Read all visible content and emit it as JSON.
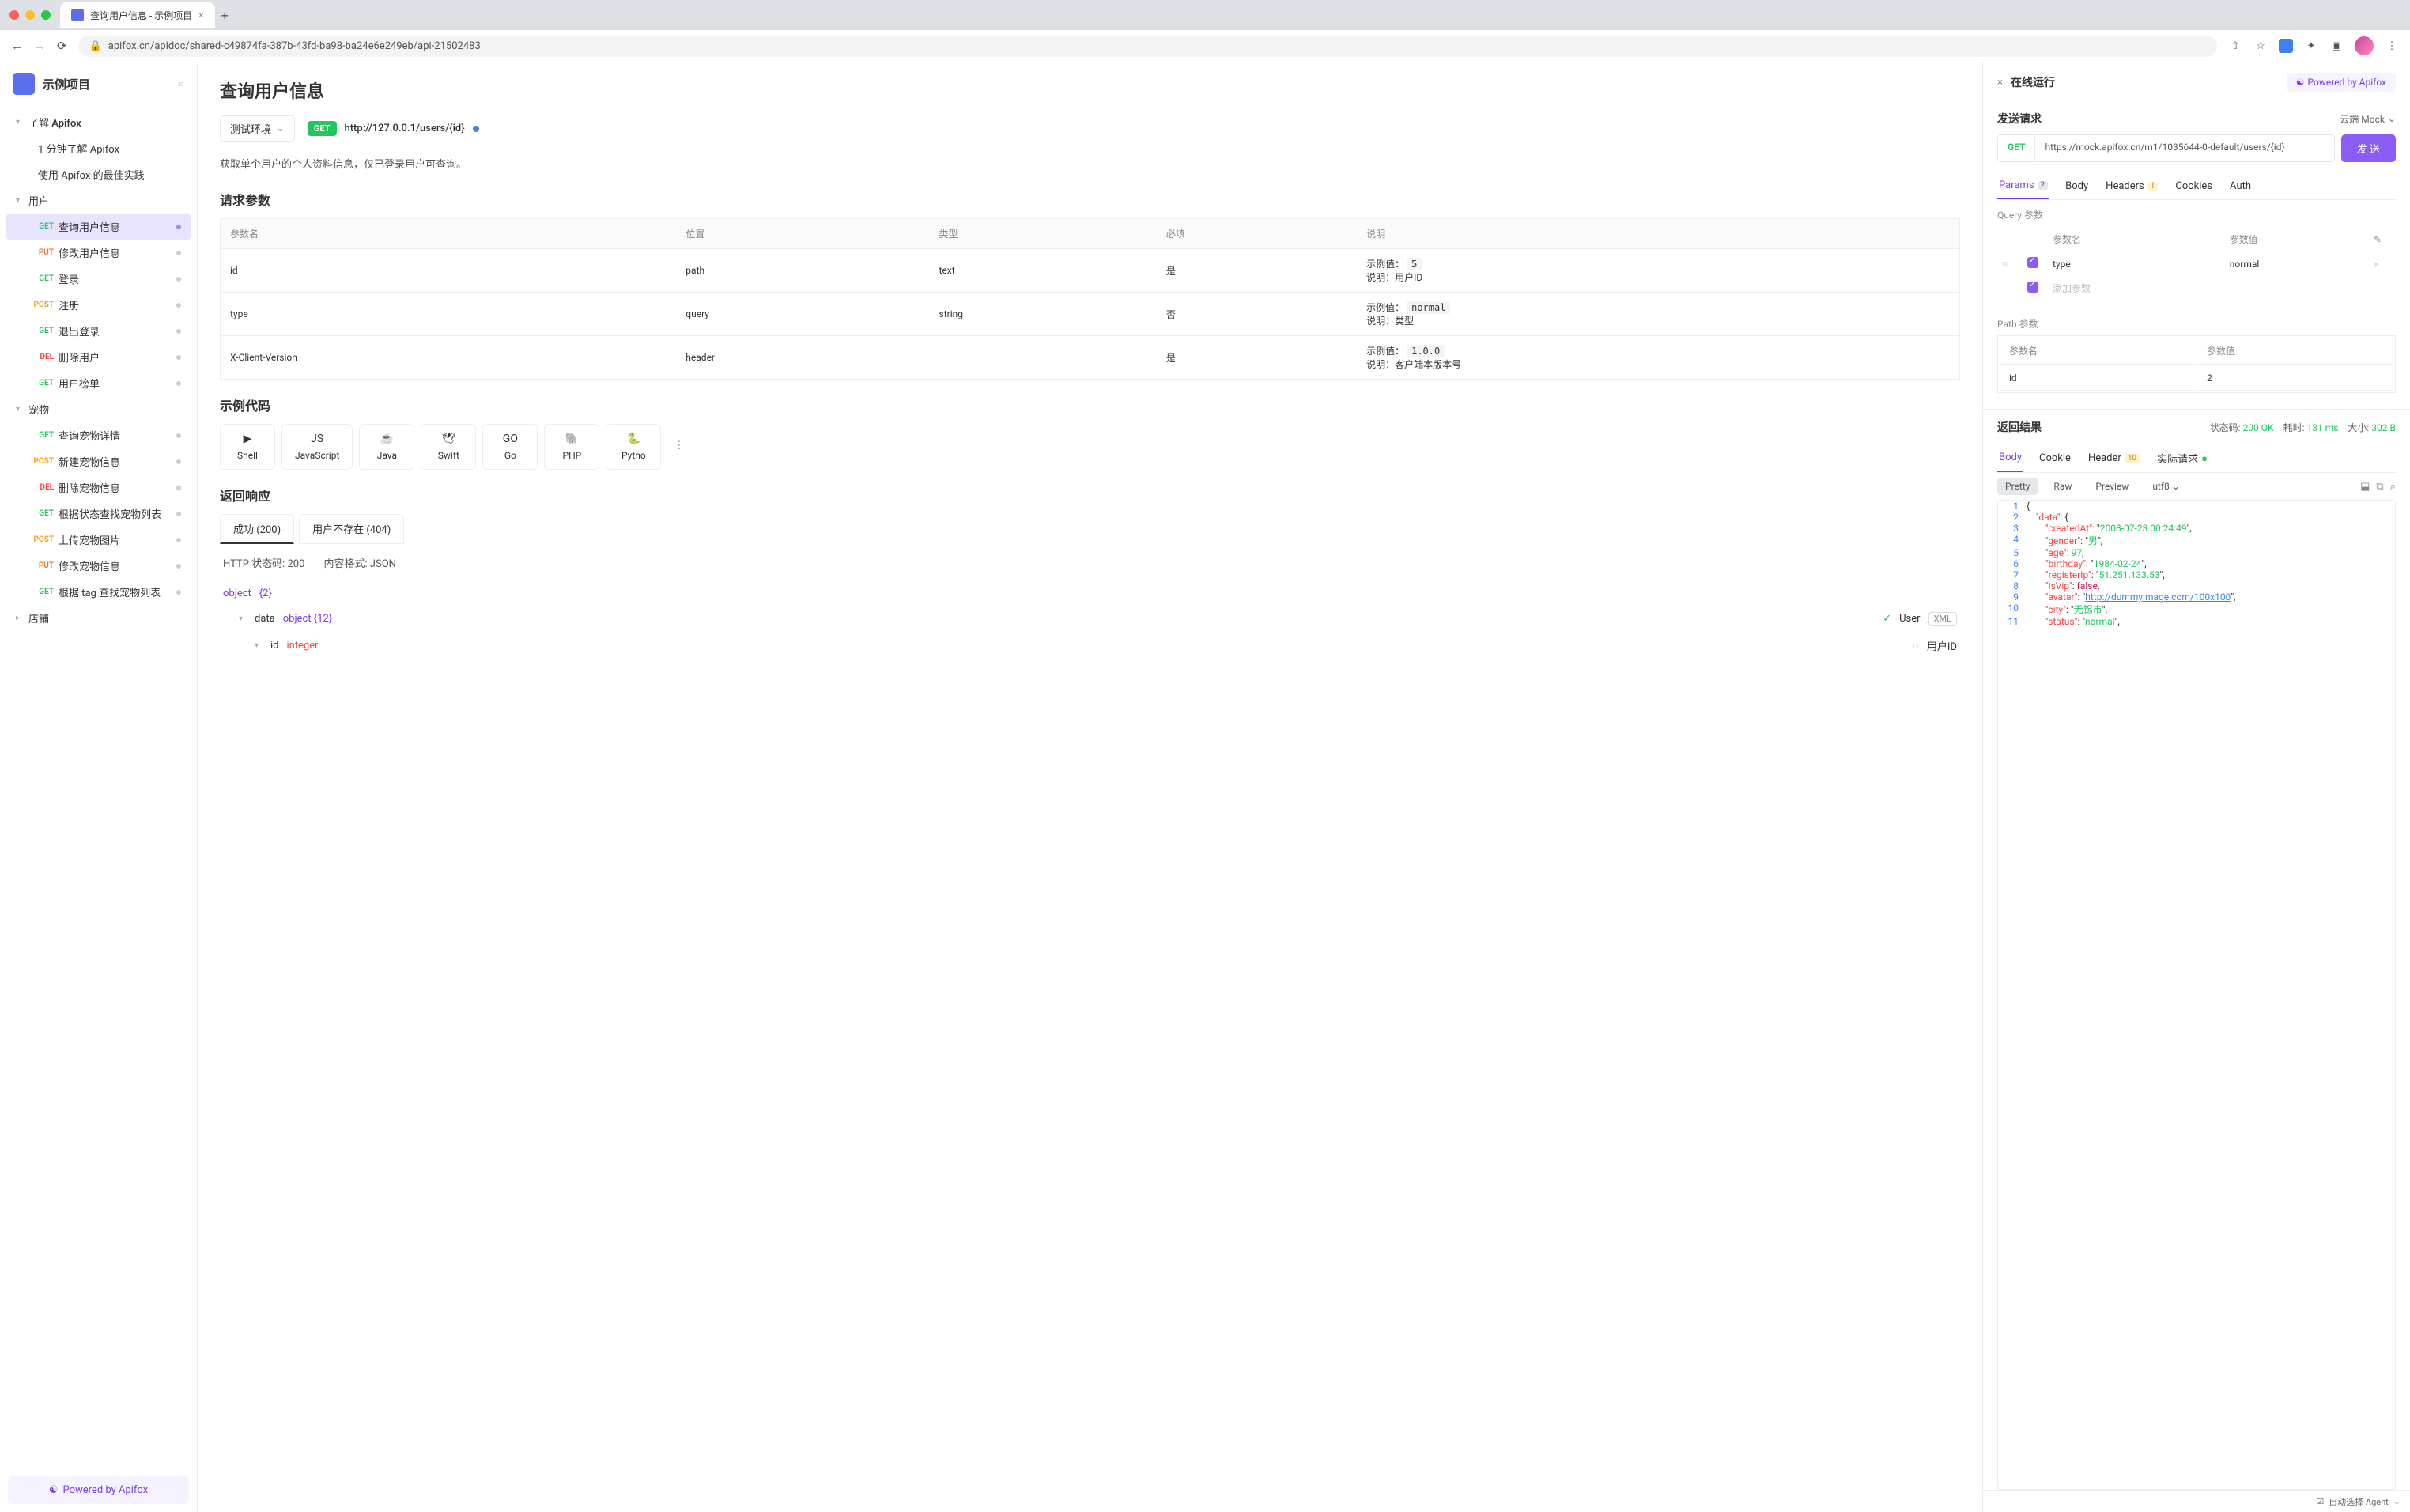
{
  "browser": {
    "tabTitle": "查询用户信息 - 示例项目",
    "url": "apifox.cn/apidoc/shared-c49874fa-387b-43fd-ba98-ba24e6e249eb/api-21502483"
  },
  "sidebar": {
    "projectTitle": "示例项目",
    "groups": [
      {
        "label": "了解 Apifox",
        "expanded": true,
        "items": [
          {
            "type": "doc",
            "label": "1 分钟了解 Apifox"
          },
          {
            "type": "doc",
            "label": "使用 Apifox 的最佳实践"
          }
        ]
      },
      {
        "label": "用户",
        "expanded": true,
        "items": [
          {
            "method": "GET",
            "label": "查询用户信息",
            "active": true
          },
          {
            "method": "PUT",
            "label": "修改用户信息"
          },
          {
            "method": "GET",
            "label": "登录"
          },
          {
            "method": "POST",
            "label": "注册"
          },
          {
            "method": "GET",
            "label": "退出登录"
          },
          {
            "method": "DEL",
            "label": "删除用户"
          },
          {
            "method": "GET",
            "label": "用户榜单"
          }
        ]
      },
      {
        "label": "宠物",
        "expanded": true,
        "items": [
          {
            "method": "GET",
            "label": "查询宠物详情"
          },
          {
            "method": "POST",
            "label": "新建宠物信息"
          },
          {
            "method": "DEL",
            "label": "删除宠物信息"
          },
          {
            "method": "GET",
            "label": "根据状态查找宠物列表"
          },
          {
            "method": "POST",
            "label": "上传宠物图片"
          },
          {
            "method": "PUT",
            "label": "修改宠物信息"
          },
          {
            "method": "GET",
            "label": "根据 tag 查找宠物列表"
          }
        ]
      },
      {
        "label": "店铺",
        "expanded": false,
        "items": []
      }
    ],
    "footer": "Powered by Apifox"
  },
  "doc": {
    "title": "查询用户信息",
    "envLabel": "测试环境",
    "method": "GET",
    "url": "http://127.0.0.1/users/{id}",
    "description": "获取单个用户的个人资料信息，仅已登录用户可查询。",
    "paramsHeader": "请求参数",
    "paramColumns": {
      "name": "参数名",
      "location": "位置",
      "type": "类型",
      "required": "必填",
      "desc": "说明"
    },
    "params": [
      {
        "name": "id",
        "location": "path",
        "type": "text",
        "required": "是",
        "example": "5",
        "desc": "用户ID"
      },
      {
        "name": "type",
        "location": "query",
        "type": "string",
        "required": "否",
        "example": "normal",
        "desc": "类型"
      },
      {
        "name": "X-Client-Version",
        "location": "header",
        "type": "",
        "required": "是",
        "example": "1.0.0",
        "desc": "客户端本版本号"
      }
    ],
    "codeHeader": "示例代码",
    "codeLangs": [
      "Shell",
      "JavaScript",
      "Java",
      "Swift",
      "Go",
      "PHP",
      "Pytho"
    ],
    "responseHeader": "返回响应",
    "responseTabs": [
      {
        "label": "成功 (200)",
        "active": true
      },
      {
        "label": "用户不存在 (404)"
      }
    ],
    "httpStatus": "HTTP 状态码: 200",
    "contentFormat": "内容格式: JSON",
    "schema": [
      {
        "name": "object",
        "type": "{2}",
        "indent": 0
      },
      {
        "name": "data",
        "type": "object {12}",
        "indent": 1,
        "right": "User",
        "xml": true
      },
      {
        "name": "id",
        "type": "integer",
        "indent": 2,
        "right": "用户ID"
      }
    ]
  },
  "runner": {
    "title": "在线运行",
    "powered": "Powered by Apifox",
    "sendReq": "发送请求",
    "mockLabel": "云端 Mock",
    "method": "GET",
    "url": "https://mock.apifox.cn/m1/1035644-0-default/users/{id}",
    "sendBtn": "发 送",
    "tabs": [
      {
        "label": "Params",
        "count": "2",
        "active": true
      },
      {
        "label": "Body"
      },
      {
        "label": "Headers",
        "count": "1"
      },
      {
        "label": "Cookies"
      },
      {
        "label": "Auth"
      }
    ],
    "queryLabel": "Query 参数",
    "queryColumns": {
      "name": "参数名",
      "value": "参数值"
    },
    "queryRows": [
      {
        "name": "type",
        "value": "normal",
        "checked": true
      },
      {
        "name": "添加参数",
        "value": "",
        "checked": true,
        "placeholder": true
      }
    ],
    "pathLabel": "Path 参数",
    "pathColumns": {
      "name": "参数名",
      "value": "参数值"
    },
    "pathRows": [
      {
        "name": "id",
        "value": "2"
      }
    ],
    "resultTitle": "返回结果",
    "resultMeta": {
      "statusLabel": "状态码:",
      "status": "200 OK",
      "timeLabel": "耗时:",
      "time": "131 ms",
      "sizeLabel": "大小:",
      "size": "302 B"
    },
    "resultTabs": [
      {
        "label": "Body",
        "active": true
      },
      {
        "label": "Cookie"
      },
      {
        "label": "Header",
        "count": "10"
      },
      {
        "label": "实际请求",
        "dot": true
      }
    ],
    "viewModes": [
      "Pretty",
      "Raw",
      "Preview"
    ],
    "encoding": "utf8",
    "jsonLines": [
      {
        "n": 1,
        "t": "{"
      },
      {
        "n": 2,
        "t": "    \"data\": {",
        "k": "data"
      },
      {
        "n": 3,
        "t": "        \"createdAt\": \"2008-07-23 00:24:49\",",
        "k": "createdAt",
        "v": "2008-07-23 00:24:49",
        "vt": "s"
      },
      {
        "n": 4,
        "t": "        \"gender\": \"男\",",
        "k": "gender",
        "v": "男",
        "vt": "s"
      },
      {
        "n": 5,
        "t": "        \"age\": 97,",
        "k": "age",
        "v": "97",
        "vt": "n"
      },
      {
        "n": 6,
        "t": "        \"birthday\": \"1984-02-24\",",
        "k": "birthday",
        "v": "1984-02-24",
        "vt": "s"
      },
      {
        "n": 7,
        "t": "        \"registerIp\": \"51.251.133.53\",",
        "k": "registerIp",
        "v": "51.251.133.53",
        "vt": "s"
      },
      {
        "n": 8,
        "t": "        \"isVip\": false,",
        "k": "isVip",
        "v": "false",
        "vt": "b"
      },
      {
        "n": 9,
        "t": "        \"avatar\": \"http://dummyimage.com/100x100\",",
        "k": "avatar",
        "v": "http://dummyimage.com/100x100",
        "vt": "l"
      },
      {
        "n": 10,
        "t": "        \"city\": \"无锡市\",",
        "k": "city",
        "v": "无锡市",
        "vt": "s"
      },
      {
        "n": 11,
        "t": "        \"status\": \"normal\",",
        "k": "status",
        "v": "normal",
        "vt": "s"
      }
    ],
    "bottomBar": "自动选择 Agent"
  },
  "labels": {
    "exampleVal": "示例值：",
    "descPrefix": "说明："
  }
}
